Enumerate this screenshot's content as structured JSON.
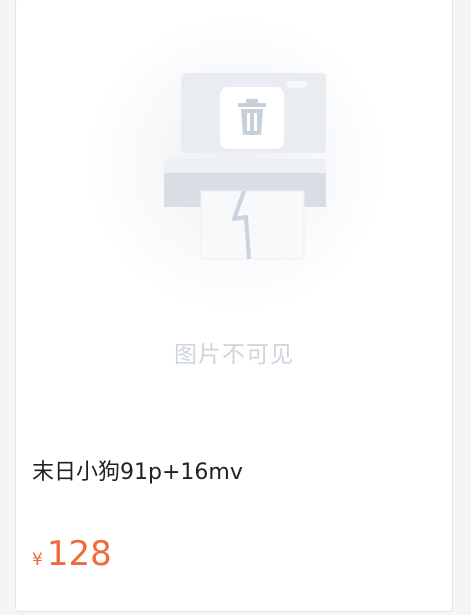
{
  "product": {
    "image_placeholder_text": "图片不可见",
    "title": "末日小狗91p+16mv",
    "currency_symbol": "¥",
    "price": "128"
  },
  "icons": {
    "placeholder": "broken-image-printer-icon",
    "trash": "trash-icon"
  },
  "colors": {
    "price": "#f06a3a",
    "title": "#222222",
    "placeholder_text": "#cfd5dd"
  }
}
